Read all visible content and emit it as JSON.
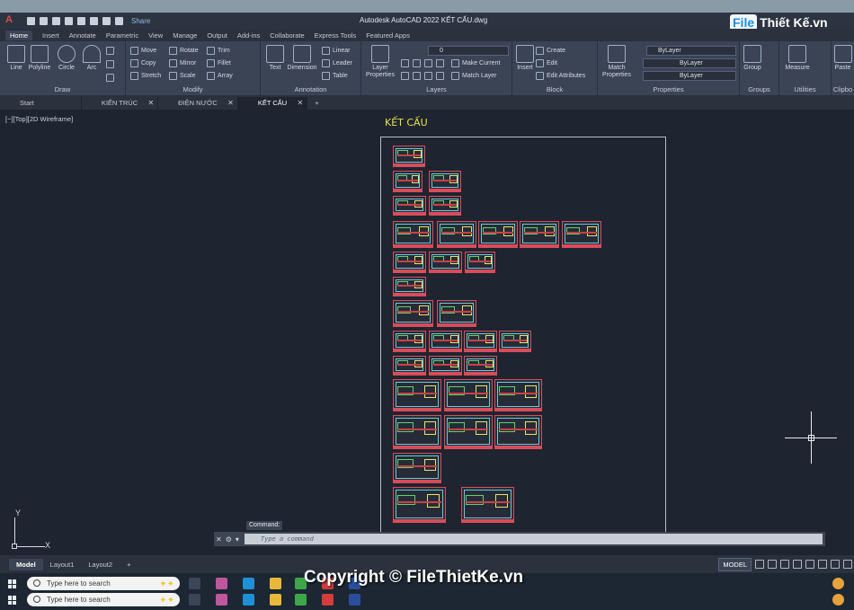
{
  "app": {
    "logo_glyph": "A",
    "title": "Autodesk AutoCAD 2022    KẾT CẤU.dwg",
    "share_label": "Share",
    "brand_left": "File",
    "brand_right": "Thiết Kế.vn"
  },
  "ribbon_tabs": [
    "Home",
    "Insert",
    "Annotate",
    "Parametric",
    "View",
    "Manage",
    "Output",
    "Add-ins",
    "Collaborate",
    "Express Tools",
    "Featured Apps"
  ],
  "ribbon": {
    "draw": {
      "title": "Draw",
      "tools": [
        "Line",
        "Polyline",
        "Circle",
        "Arc"
      ]
    },
    "modify": {
      "title": "Modify",
      "rows": [
        [
          "Move",
          "Rotate",
          "Trim"
        ],
        [
          "Copy",
          "Mirror",
          "Fillet"
        ],
        [
          "Stretch",
          "Scale",
          "Array"
        ]
      ]
    },
    "annotation": {
      "title": "Annotation",
      "tools": [
        "Text",
        "Dimension"
      ],
      "rows": [
        "Linear",
        "Leader",
        "Table"
      ]
    },
    "layers": {
      "title": "Layers",
      "tool": "Layer Properties",
      "layer_value": "0",
      "rows": [
        "Make Current",
        "Match Layer"
      ]
    },
    "block": {
      "title": "Block",
      "tool": "Insert",
      "rows": [
        "Create",
        "Edit",
        "Edit Attributes"
      ]
    },
    "properties": {
      "title": "Properties",
      "tool": "Match Properties",
      "combos": [
        "ByLayer",
        "ByLayer",
        "ByLayer"
      ]
    },
    "groups": {
      "title": "Groups",
      "tool": "Group"
    },
    "utilities": {
      "title": "Utilities",
      "tool": "Measure"
    },
    "clipboard": {
      "title": "Clipbo",
      "tool": "Paste"
    }
  },
  "doc_tabs": [
    "Start",
    "KIẾN TRÚC",
    "ĐIỆN NƯỚC",
    "KẾT CẤU"
  ],
  "doc_tab_plus": "+",
  "viewport": {
    "label": "[−][Top][2D Wireframe]",
    "drawing_title": "KẾT CẤU"
  },
  "ucs": {
    "y": "Y",
    "x": "X"
  },
  "command": {
    "label": "Command:",
    "placeholder": "Type a command"
  },
  "layout_tabs": [
    "Model",
    "Layout1",
    "Layout2"
  ],
  "layout_plus": "+",
  "status": {
    "model": "MODEL"
  },
  "taskbar": {
    "search_placeholder_1": "Type here to search",
    "search_placeholder_2": "Type here to search"
  },
  "watermark": "Copyright © FileThietKe.vn",
  "colors": {
    "canvas": "#1e2430",
    "ribbon": "#3b4455",
    "sheet_border": "#d94c5a",
    "title_yellow": "#e9e050"
  }
}
